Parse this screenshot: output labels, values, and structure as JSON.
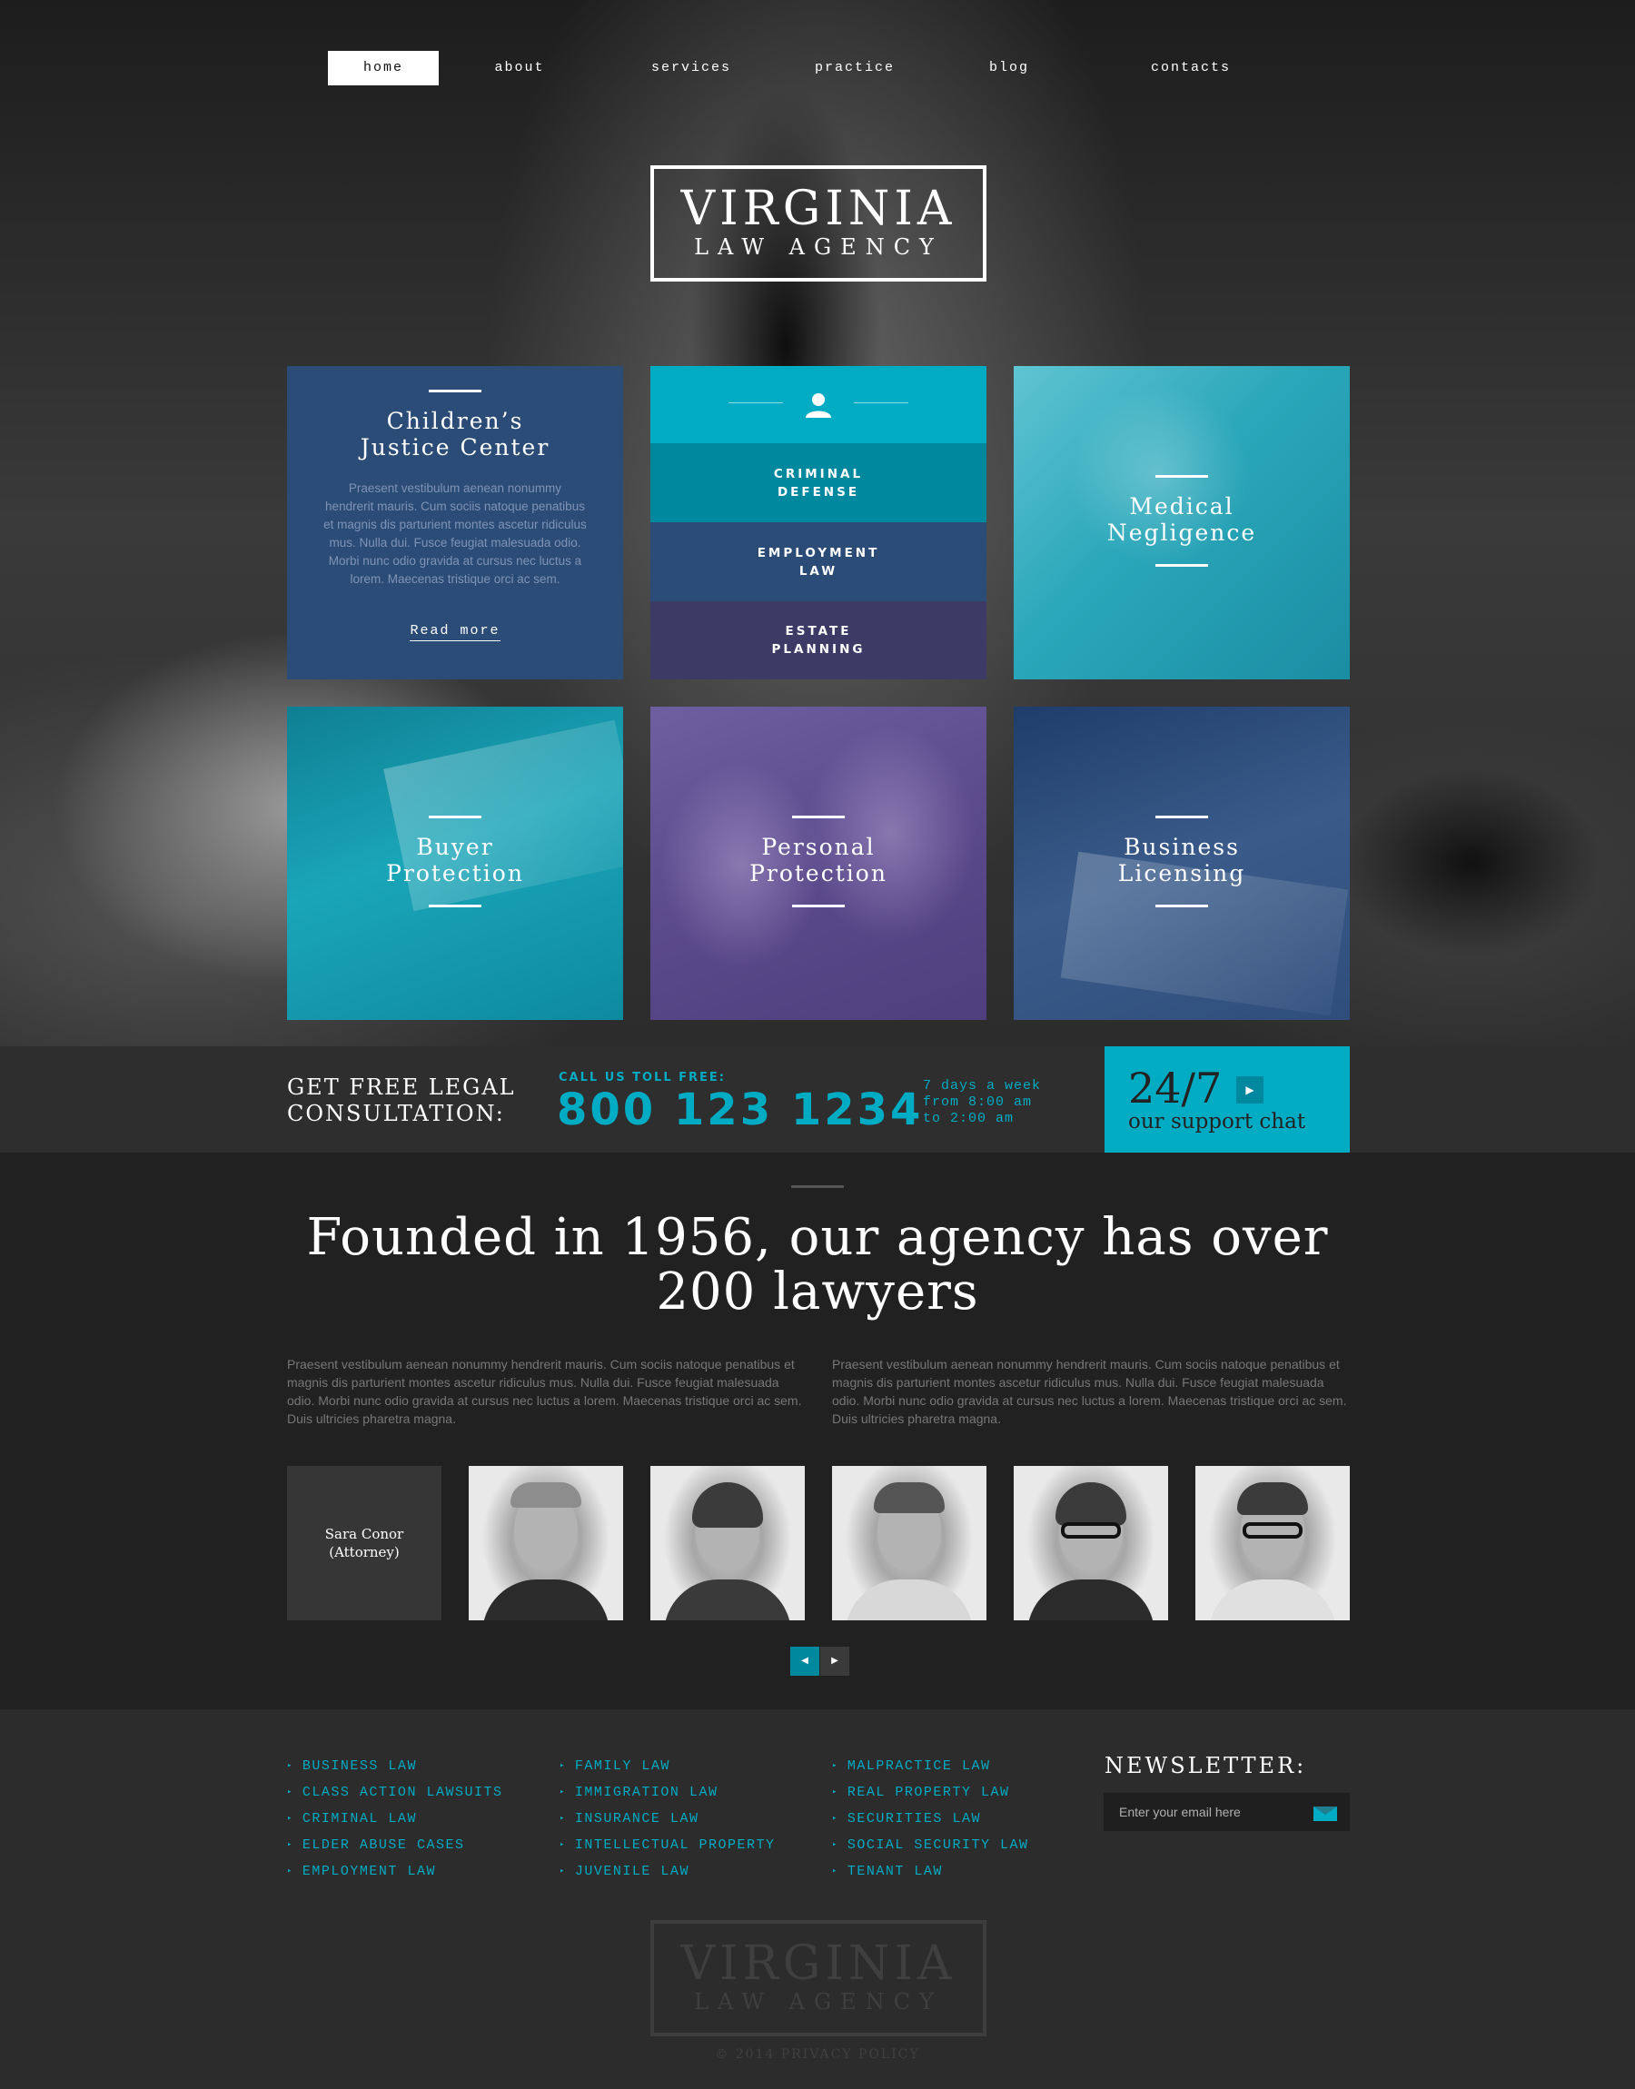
{
  "nav": {
    "items": [
      "home",
      "about",
      "services",
      "practice",
      "blog",
      "contacts"
    ]
  },
  "logo": {
    "title": "VIRGINIA",
    "subtitle": "LAW AGENCY"
  },
  "tiles": {
    "childrens": {
      "title": "Children’s Justice Center",
      "text": "Praesent vestibulum aenean nonummy hendrerit mauris. Cum sociis natoque penatibus et magnis dis parturient montes ascetur ridiculus mus. Nulla dui. Fusce feugiat malesuada odio. Morbi nunc odio gravida at cursus nec luctus a lorem. Maecenas tristique orci ac sem.",
      "link": "Read more"
    },
    "practice_list": [
      "CRIMINAL DEFENSE",
      "EMPLOYMENT LAW",
      "ESTATE PLANNING"
    ],
    "medical": "Medical Negligence",
    "buyer": "Buyer Protection",
    "personal": "Personal Protection",
    "business": "Business Licensing"
  },
  "consult": {
    "title": "GET FREE LEGAL CONSULTATION:",
    "toll_label": "CALL US TOLL FREE:",
    "phone": "800 123 1234",
    "hours": "7 days a week from 8:00 am to 2:00 am",
    "support_big": "24/7",
    "support_small": "our support chat"
  },
  "about": {
    "heading": "Founded in 1956, our agency has over 200 lawyers",
    "col1": "Praesent vestibulum aenean nonummy hendrerit mauris. Cum sociis natoque penatibus et magnis dis parturient montes ascetur ridiculus mus. Nulla dui. Fusce feugiat malesuada odio. Morbi nunc odio gravida at cursus nec luctus a lorem. Maecenas tristique orci ac sem. Duis ultricies pharetra magna.",
    "col2": "Praesent vestibulum aenean nonummy hendrerit mauris. Cum sociis natoque penatibus et magnis dis parturient montes ascetur ridiculus mus. Nulla dui. Fusce feugiat malesuada odio. Morbi nunc odio gravida at cursus nec luctus a lorem. Maecenas tristique orci ac sem. Duis ultricies pharetra magna."
  },
  "team": {
    "name": "Sara Conor",
    "role": "(Attorney)"
  },
  "footer": {
    "col1": [
      "BUSINESS LAW",
      "CLASS ACTION LAWSUITS",
      "CRIMINAL LAW",
      "ELDER ABUSE CASES",
      "EMPLOYMENT LAW"
    ],
    "col2": [
      "FAMILY LAW",
      "IMMIGRATION LAW",
      "INSURANCE LAW",
      "INTELLECTUAL PROPERTY",
      "JUVENILE LAW"
    ],
    "col3": [
      "MALPRACTICE LAW",
      "REAL PROPERTY LAW",
      "SECURITIES LAW",
      "SOCIAL SECURITY LAW",
      "TENANT LAW"
    ],
    "newsletter_title": "NEWSLETTER:",
    "newsletter_placeholder": "Enter your email here",
    "copyright": "© 2014 PRIVACY POLICY"
  },
  "colors": {
    "accent": "#00abc4",
    "navy": "#2b4c77",
    "purple": "#3e3a66",
    "dark": "#212121"
  }
}
